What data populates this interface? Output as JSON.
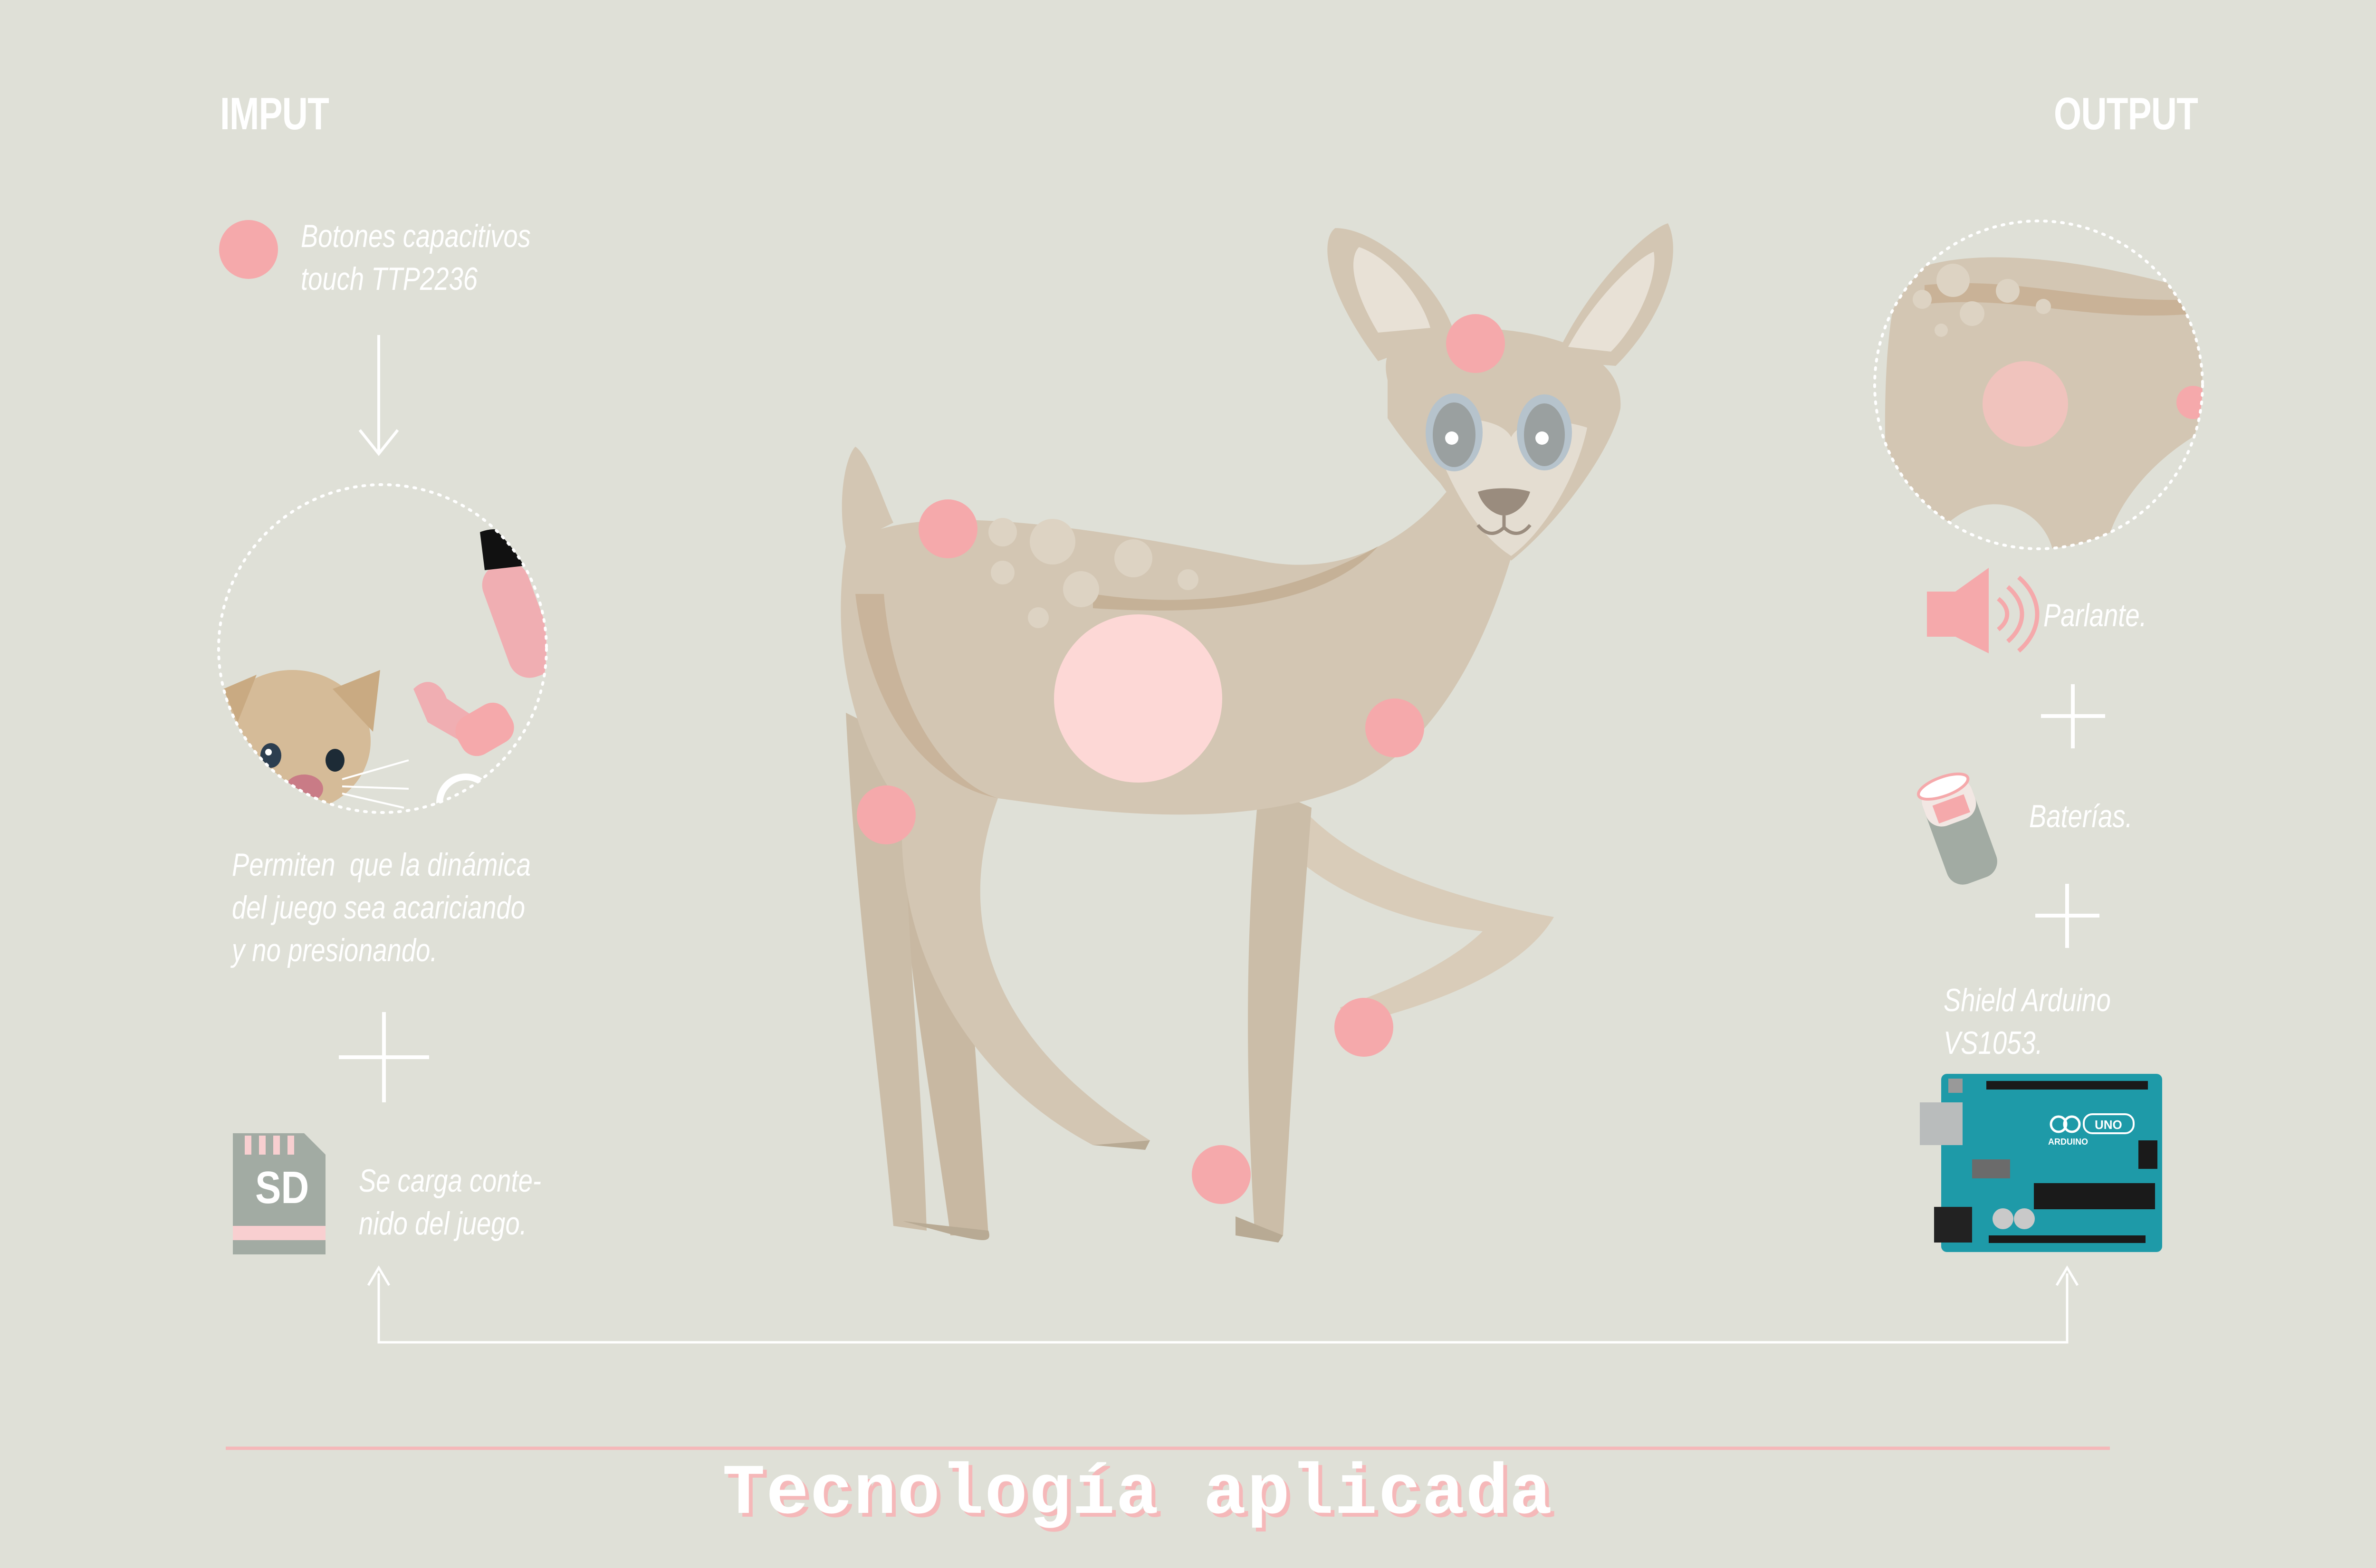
{
  "input": {
    "heading": "IMPUT",
    "sensor_label": "Botones capacitivos\ntouch TTP2236",
    "description": "Permiten  que la dinámica\ndel juego sea acariciando\ny no presionando.",
    "sd_icon_text": "SD",
    "sd_label": "Se carga conte-\nnido del juego."
  },
  "output": {
    "heading": "OUTPUT",
    "speaker_label": "Parlante.",
    "battery_label": "Baterías.",
    "shield_label": "Shield Arduino\nVS1053.",
    "arduino_brand": "ARDUINO",
    "arduino_model": "UNO"
  },
  "footer": {
    "title": "Tecnología aplicada"
  },
  "colors": {
    "background": "#dfe0d7",
    "accent_pink": "#f5a9ab",
    "text": "#ffffff",
    "deer_body": "#d3c6b3"
  }
}
